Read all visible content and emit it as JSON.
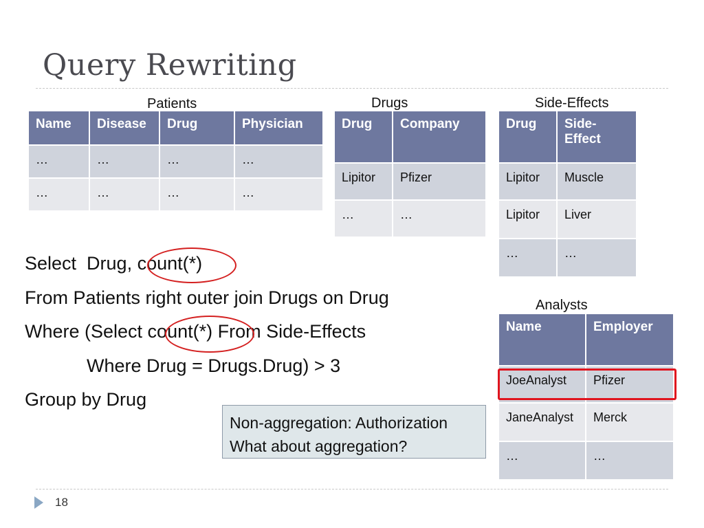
{
  "slide": {
    "title": "Query Rewriting",
    "page_number": "18"
  },
  "tables": {
    "patients": {
      "caption": "Patients",
      "headers": [
        "Name",
        "Disease",
        "Drug",
        "Physician"
      ],
      "rows": [
        [
          "…",
          "…",
          "…",
          "…"
        ],
        [
          "…",
          "…",
          "…",
          "…"
        ]
      ]
    },
    "drugs": {
      "caption": "Drugs",
      "headers": [
        "Drug",
        "Company"
      ],
      "rows": [
        [
          "Lipitor",
          "Pfizer"
        ],
        [
          "…",
          "…"
        ]
      ]
    },
    "side_effects": {
      "caption": "Side-Effects",
      "headers": [
        "Drug",
        "Side-Effect"
      ],
      "rows": [
        [
          "Lipitor",
          "Muscle"
        ],
        [
          "Lipitor",
          "Liver"
        ],
        [
          "…",
          "…"
        ]
      ]
    },
    "analysts": {
      "caption": "Analysts",
      "headers": [
        "Name",
        "Employer"
      ],
      "rows": [
        [
          "JoeAnalyst",
          "Pfizer"
        ],
        [
          "JaneAnalyst",
          "Merck"
        ],
        [
          "…",
          "…"
        ]
      ],
      "highlighted_row": 0
    }
  },
  "query": {
    "lines": [
      "Select  Drug, count(*)",
      "From Patients right outer join Drugs on Drug",
      "Where (Select count(*) From Side-Effects",
      "            Where Drug = Drugs.Drug) > 3",
      "Group by Drug"
    ],
    "circled_terms": [
      "count(*)",
      "count(*)"
    ]
  },
  "note": {
    "line1": "Non-aggregation: Authorization",
    "line2": "What about aggregation?"
  },
  "colors": {
    "header_fill": "#6e789f",
    "row_dark": "#cfd3dc",
    "row_light": "#e7e8ec",
    "highlight": "#e0141e",
    "note_fill": "#dfe7ea"
  }
}
